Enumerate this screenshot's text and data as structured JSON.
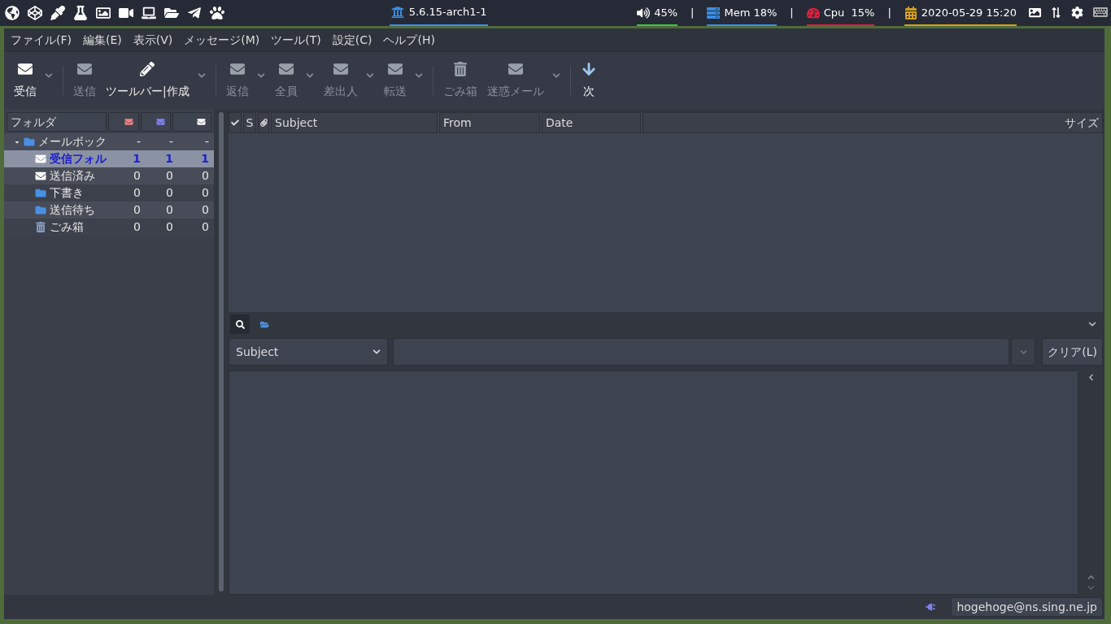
{
  "panel": {
    "kernel": "5.6.15-arch1-1",
    "indicators": [
      {
        "kind": "volume",
        "text": "45%",
        "color": "#3cc83c"
      },
      {
        "kind": "memory",
        "text": "Mem 18%",
        "color": "#3a8ee6"
      },
      {
        "kind": "cpu",
        "text": "Cpu  15%",
        "color": "#e0203c"
      },
      {
        "kind": "date",
        "text": "2020-05-29 15:20",
        "color": "#d4a017"
      }
    ],
    "separator": "|"
  },
  "menu": [
    "ファイル(F)",
    "編集(E)",
    "表示(V)",
    "メッセージ(M)",
    "ツール(T)",
    "設定(C)",
    "ヘルプ(H)"
  ],
  "toolbar": [
    {
      "kind": "button",
      "label": "受信",
      "disabled": false,
      "dropdown": true
    },
    {
      "kind": "separator"
    },
    {
      "kind": "button",
      "label": "送信",
      "disabled": true,
      "dropdown": false
    },
    {
      "kind": "button",
      "label": "ツールバー|作成",
      "disabled": false,
      "dropdown": true
    },
    {
      "kind": "separator"
    },
    {
      "kind": "button",
      "label": "返信",
      "disabled": true,
      "dropdown": true
    },
    {
      "kind": "button",
      "label": "全員",
      "disabled": true,
      "dropdown": true
    },
    {
      "kind": "button",
      "label": "差出人",
      "disabled": true,
      "dropdown": true
    },
    {
      "kind": "button",
      "label": "転送",
      "disabled": true,
      "dropdown": true
    },
    {
      "kind": "separator"
    },
    {
      "kind": "button",
      "label": "ごみ箱",
      "disabled": true,
      "dropdown": false
    },
    {
      "kind": "button",
      "label": "迷惑メール",
      "disabled": true,
      "dropdown": true
    },
    {
      "kind": "separator"
    },
    {
      "kind": "button",
      "label": "次",
      "disabled": false,
      "dropdown": false
    }
  ],
  "folders": {
    "header": "フォルダ",
    "tree": [
      {
        "name": "メールボック",
        "kind": "mailbox",
        "counts": [
          "-",
          "-",
          "-"
        ],
        "expanded": true,
        "selected": false,
        "children": [
          {
            "name": "受信フォル",
            "kind": "inbox",
            "counts": [
              "1",
              "1",
              "1"
            ],
            "selected": true
          },
          {
            "name": "送信済み",
            "kind": "sent",
            "counts": [
              "0",
              "0",
              "0"
            ],
            "selected": false
          },
          {
            "name": "下書き",
            "kind": "draft",
            "counts": [
              "0",
              "0",
              "0"
            ],
            "selected": false
          },
          {
            "name": "送信待ち",
            "kind": "queue",
            "counts": [
              "0",
              "0",
              "0"
            ],
            "selected": false
          },
          {
            "name": "ごみ箱",
            "kind": "trash",
            "counts": [
              "0",
              "0",
              "0"
            ],
            "selected": false
          }
        ]
      }
    ]
  },
  "messages": {
    "columns": [
      "S",
      "Subject",
      "From",
      "Date",
      "サイズ"
    ]
  },
  "search": {
    "tabs": [
      {
        "kind": "search",
        "selected": true
      },
      {
        "kind": "folder",
        "selected": false
      }
    ],
    "field": "Subject",
    "clear": "クリア(L)"
  },
  "status_bar": {
    "account": "hogehoge@ns.sing.ne.jp"
  }
}
